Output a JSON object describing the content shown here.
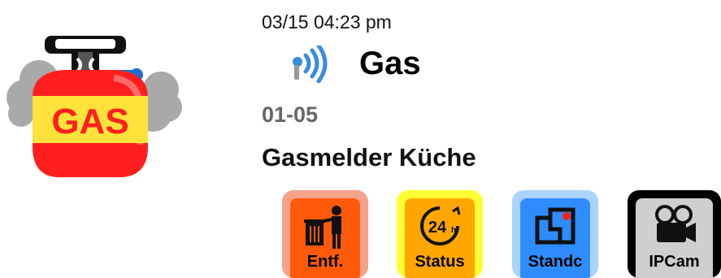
{
  "header": {
    "timestamp": "03/15 04:23 pm",
    "device_type": "Gas",
    "zone_id": "01-05",
    "device_name": "Gasmelder Küche"
  },
  "illustration": {
    "label": "GAS",
    "icon": "gas-cylinder-icon"
  },
  "status_icon": "wireless-signal-icon",
  "actions": [
    {
      "label": "Entf.",
      "icon": "trash-person-icon"
    },
    {
      "label": "Status",
      "icon": "24hr-icon"
    },
    {
      "label": "Standc",
      "icon": "standby-panel-icon"
    },
    {
      "label": "IPCam",
      "icon": "video-camera-icon"
    }
  ],
  "colors": {
    "remove": "#ff5a0a",
    "status": "#ffa600",
    "standby": "#2f8cff",
    "ipcam": "#cfcfcf"
  }
}
